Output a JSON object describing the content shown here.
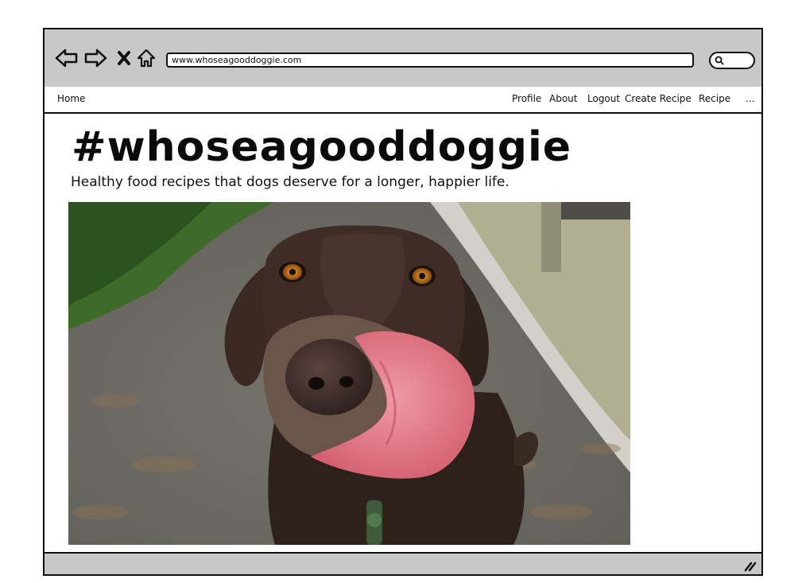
{
  "browser": {
    "url": "www.whoseagooddoggie.com",
    "buttons": [
      "back-icon",
      "forward-icon",
      "stop-icon",
      "home-icon"
    ]
  },
  "nav": {
    "home": "Home",
    "profile": "Profile",
    "about": "About",
    "logout": "Logout",
    "create_recipe": "Create Recipe",
    "recipe": "Recipe",
    "more": "..."
  },
  "header": {
    "title": "#whoseagooddoggie",
    "subtitle": "Healthy food recipes that dogs deserve for a longer, happier life."
  },
  "hero": {
    "image_icon": "dog-photo",
    "colors": {
      "coat": "#3a2a24",
      "tongue": "#e07a86",
      "path": "#8c8a82",
      "foliage": "#3d6a2a"
    }
  }
}
